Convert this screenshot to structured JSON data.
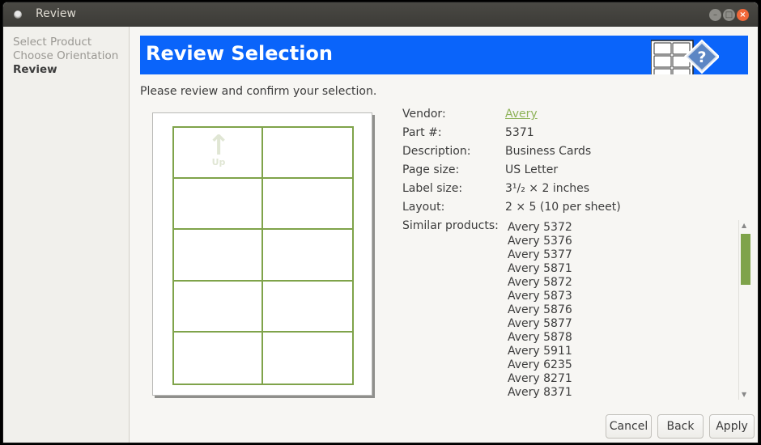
{
  "window": {
    "title": "Review",
    "controls": [
      "minimize",
      "maximize",
      "close"
    ]
  },
  "sidebar": {
    "steps": [
      {
        "label": "Select Product",
        "active": false
      },
      {
        "label": "Choose Orientation",
        "active": false
      },
      {
        "label": "Review",
        "active": true
      }
    ]
  },
  "banner": {
    "title": "Review Selection",
    "icon": "label-sheet-help-icon",
    "color": "#0a64fa"
  },
  "instructions": "Please review and confirm your selection.",
  "preview": {
    "orientation_label": "Up",
    "columns": 2,
    "rows": 5,
    "accent": "#7fa34a"
  },
  "details": {
    "vendor": {
      "label": "Vendor:",
      "value": "Avery"
    },
    "part": {
      "label": "Part #:",
      "value": "5371"
    },
    "description": {
      "label": "Description:",
      "value": "Business Cards"
    },
    "page_size": {
      "label": "Page size:",
      "value": "US Letter"
    },
    "label_size": {
      "label": "Label size:",
      "value": "3¹/₂ × 2 inches"
    },
    "layout": {
      "label": "Layout:",
      "value": "2 × 5 (10 per sheet)"
    },
    "similar": {
      "label": "Similar products:",
      "items": [
        "Avery 5372",
        "Avery 5376",
        "Avery 5377",
        "Avery 5871",
        "Avery 5872",
        "Avery 5873",
        "Avery 5876",
        "Avery 5877",
        "Avery 5878",
        "Avery 5911",
        "Avery 6235",
        "Avery 8271",
        "Avery 8371"
      ]
    }
  },
  "buttons": {
    "cancel": "Cancel",
    "back": "Back",
    "apply": "Apply"
  }
}
